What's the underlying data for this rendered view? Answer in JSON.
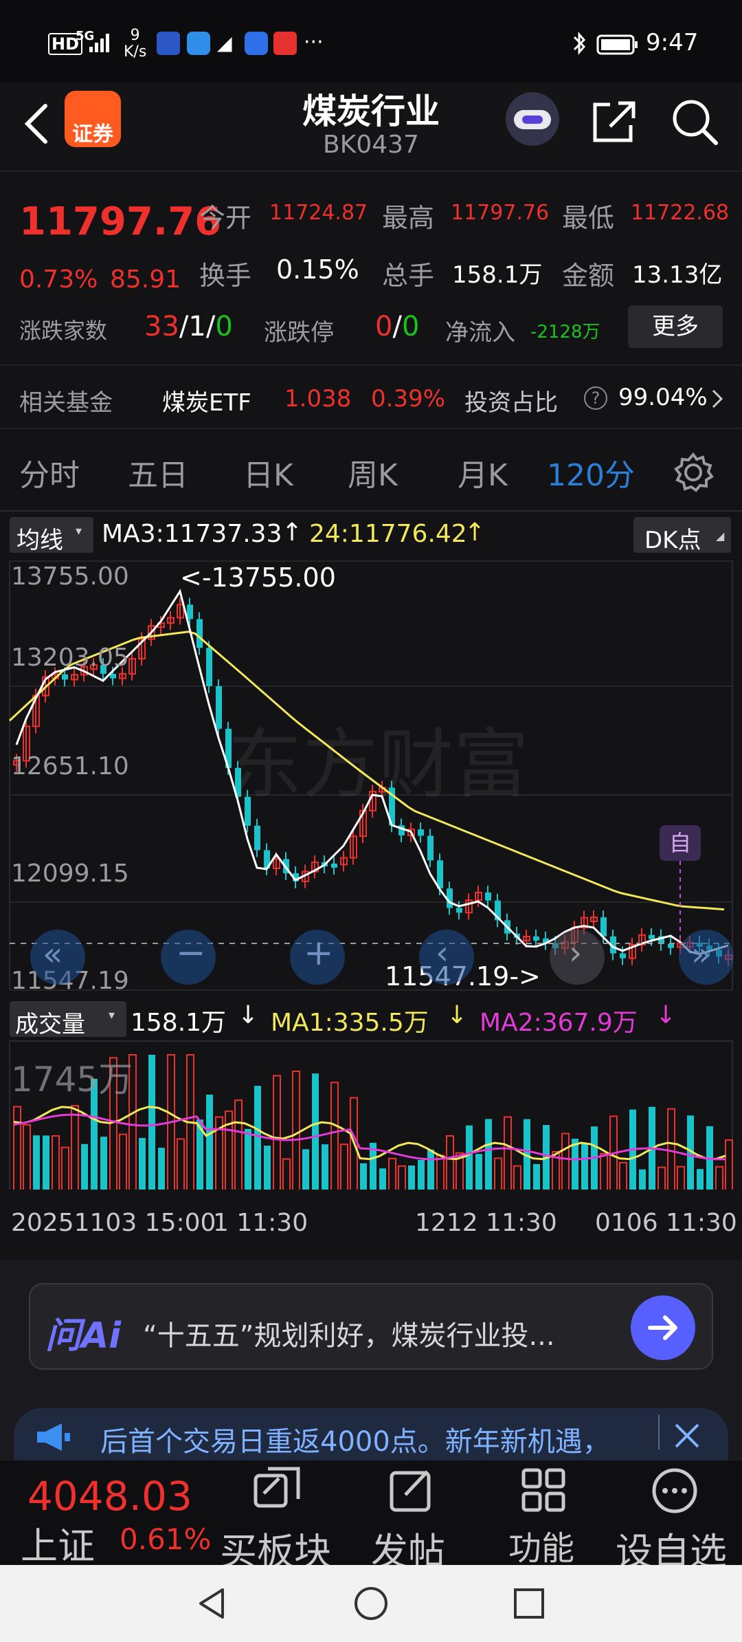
{
  "status_bar": {
    "left_icons": [
      "HD",
      "5G",
      "9\nK/s"
    ],
    "net_speed_num": "9",
    "net_speed_unit": "K/s",
    "time": "9:47",
    "more": "···"
  },
  "header": {
    "app_badge": "证券",
    "title": "煤炭行业",
    "code": "BK0437"
  },
  "quote": {
    "price": "11797.76",
    "change_pct": "0.73%",
    "change_abs": "85.91",
    "open_label": "今开",
    "open": "11724.87",
    "high_label": "最高",
    "high": "11797.76",
    "low_label": "最低",
    "low": "11722.68",
    "turnover_label": "换手",
    "turnover": "0.15%",
    "volume_label": "总手",
    "volume": "158.1万",
    "amount_label": "金额",
    "amount": "13.13亿",
    "advdec_label": "涨跌家数",
    "adv": "33",
    "flat": "1",
    "dec": "0",
    "limit_label": "涨跌停",
    "limit_up": "0",
    "limit_down": "0",
    "netflow_label": "净流入",
    "netflow": "-2128万",
    "more_button": "更多"
  },
  "fund": {
    "label": "相关基金",
    "name": "煤炭ETF",
    "price": "1.038",
    "pct": "0.39%",
    "ratio_label": "投资占比",
    "ratio": "99.04%"
  },
  "tabs": [
    "分时",
    "五日",
    "日K",
    "周K",
    "月K",
    "120分"
  ],
  "active_tab": "120分",
  "indicator": {
    "selector": "均线",
    "ma3": "MA3:11737.33",
    "ma24": "24:11776.42",
    "dk_button": "DK点"
  },
  "chart_data": {
    "type": "candlestick",
    "y_ticks": [
      "13755.00",
      "13203.05",
      "12651.10",
      "12099.15",
      "11547.19"
    ],
    "max_label": "<-13755.00",
    "min_label": "11547.19->",
    "x_ticks": [
      "20251103 15:00",
      "1 11:30",
      "1212 11:30",
      "0106 11:30"
    ],
    "self_marker": "自",
    "ylim": [
      11547.19,
      13755.0
    ]
  },
  "volume": {
    "selector": "成交量",
    "vol": "158.1万",
    "ma1": "MA1:335.5万",
    "ma2": "MA2:367.9万",
    "top_label": "1745万"
  },
  "ai_bar": {
    "logo": "问Ai",
    "text": "“十五五”规划利好，煤炭行业投..."
  },
  "ticker": {
    "text": "后首个交易日重返4000点。新年新机遇，"
  },
  "bottom_nav": {
    "index_price": "4048.03",
    "index_name": "上证",
    "index_pct": "0.61%",
    "items": [
      "买板块",
      "发帖",
      "功能",
      "设自选"
    ]
  },
  "watermark": "东方财富",
  "colors": {
    "up": "#f0302c",
    "down": "#19c3c9",
    "ma3": "#ffffff",
    "ma24": "#f2e85a",
    "accent": "#2a7fd8"
  }
}
